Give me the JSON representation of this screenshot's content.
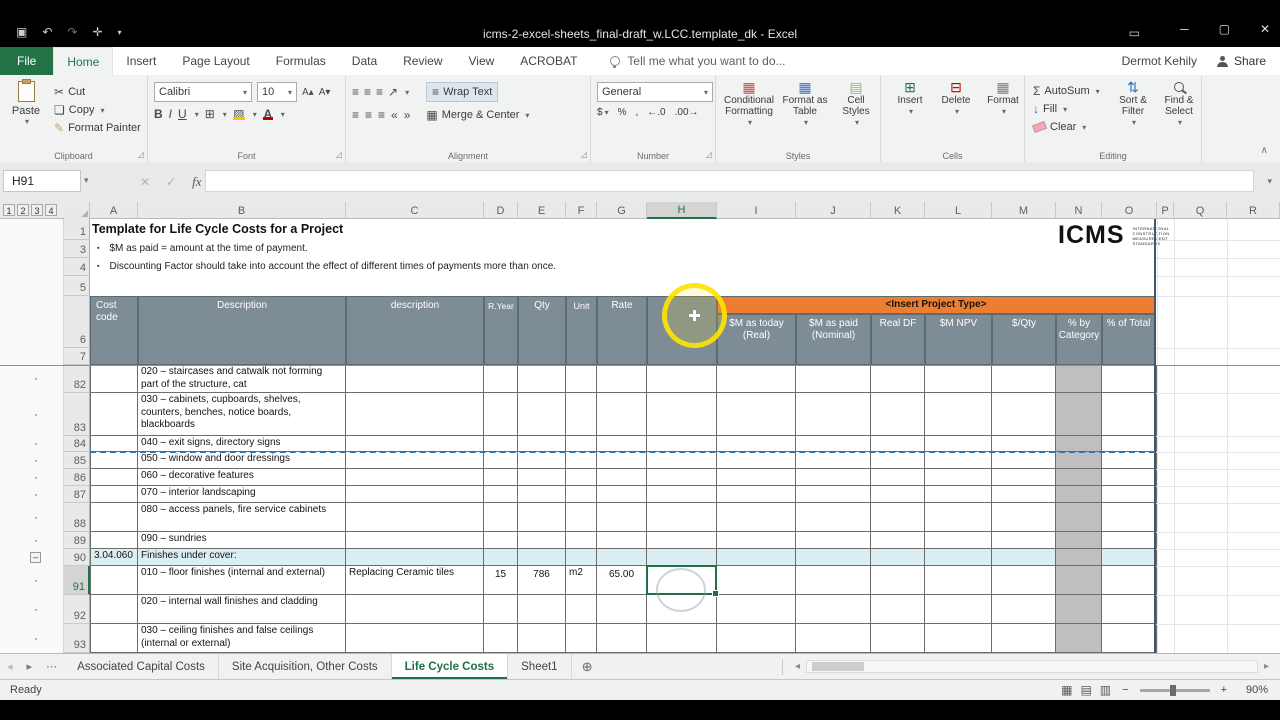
{
  "window": {
    "title": "icms-2-excel-sheets_final-draft_w.LCC.template_dk - Excel",
    "user": "Dermot Kehily",
    "share": "Share"
  },
  "icons": {
    "save": "▣",
    "undo": "↶",
    "redo": "↷",
    "touch": "✛",
    "qat_more": "▾",
    "presenter": "▭",
    "minimize": "─",
    "maximize": "▢",
    "close": "✕",
    "dropdown": "▾",
    "cut": "✂",
    "copy": "❏",
    "bold": "B",
    "italic": "I",
    "underline": "U",
    "borders": "⊞",
    "font_up": "A▴",
    "font_down": "A▾",
    "align": "≡",
    "indent_dec": "«",
    "indent_inc": "»",
    "orientation": "↗",
    "wrap": "≡",
    "merge": "▦",
    "currency": "$",
    "percent": "%",
    "comma": ",",
    "dec_inc": "←.0",
    "dec_dec": ".00→",
    "cond_format": "▦",
    "format_table": "▦",
    "cell_styles": "▤",
    "insert": "⊞",
    "delete": "⊟",
    "format": "▦",
    "sum": "Σ",
    "fill_down": "↓",
    "sort": "⇅",
    "cancel": "✕",
    "check": "✓",
    "fx": "fx",
    "nav_left": "◂",
    "nav_right": "▸",
    "more_tabs": "⋯",
    "add_sheet": "⊕",
    "view_normal": "▦",
    "view_layout": "▤",
    "view_break": "▥",
    "zoom_out": "−",
    "zoom_in": "+",
    "ribbon_collapse": "∧",
    "launcher": "◿",
    "bullet": "▪",
    "dot": "·",
    "minus_outline": "–",
    "corner_triangle": "◢",
    "plus_cursor": "✚"
  },
  "ribbon_tabs": [
    {
      "label": "File",
      "type": "file"
    },
    {
      "label": "Home",
      "active": true
    },
    {
      "label": "Insert"
    },
    {
      "label": "Page Layout"
    },
    {
      "label": "Formulas"
    },
    {
      "label": "Data"
    },
    {
      "label": "Review"
    },
    {
      "label": "View"
    },
    {
      "label": "ACROBAT"
    }
  ],
  "tellme": "Tell me what you want to do...",
  "ribbon": {
    "clipboard": {
      "label": "Clipboard",
      "paste": "Paste",
      "cut": "Cut",
      "copy": "Copy",
      "format_painter": "Format Painter"
    },
    "font": {
      "label": "Font",
      "name": "Calibri",
      "size": "10"
    },
    "alignment": {
      "label": "Alignment",
      "wrap": "Wrap Text",
      "merge": "Merge & Center"
    },
    "number": {
      "label": "Number",
      "format": "General"
    },
    "styles": {
      "label": "Styles",
      "conditional": "Conditional Formatting",
      "table": "Format as Table",
      "cell": "Cell Styles"
    },
    "cells": {
      "label": "Cells",
      "insert": "Insert",
      "delete": "Delete",
      "format": "Format"
    },
    "editing": {
      "label": "Editing",
      "autosum": "AutoSum",
      "fill": "Fill",
      "clear": "Clear",
      "sort": "Sort & Filter",
      "find": "Find & Select"
    }
  },
  "formula_bar": {
    "name_box": "H91"
  },
  "grid": {
    "columns": [
      "A",
      "B",
      "C",
      "D",
      "E",
      "F",
      "G",
      "H",
      "I",
      "J",
      "K",
      "L",
      "M",
      "N",
      "O",
      "P",
      "Q",
      "R"
    ],
    "outline_levels": [
      "1",
      "2",
      "3",
      "4"
    ],
    "top_rows": [
      "1",
      "3",
      "4",
      "5",
      "6",
      "7"
    ]
  },
  "sheet": {
    "title": "Template for Life Cycle Costs for a Project",
    "bullets": [
      "$M as paid = amount at the time of payment.",
      "Discounting Factor should take into account the effect of different times of payments more than once."
    ],
    "header": {
      "cost_code": "Cost code",
      "description": "Description",
      "description2": "description",
      "ryear": "R.Year",
      "qty": "Qty",
      "unit": "Unit",
      "rate": "Rate",
      "project": "<Insert Project Type>",
      "subs": [
        "$M as today (Real)",
        "$M as paid (Nominal)",
        "Real DF",
        "$M NPV",
        "$/Qty",
        "% by Category",
        "% of Total"
      ]
    },
    "rows": [
      {
        "num": "82",
        "cells": {
          "B": "020 – staircases and catwalk not forming part of the structure, cat"
        }
      },
      {
        "num": "83",
        "cells": {
          "B": "030 – cabinets, cupboards, shelves, counters, benches, notice boards, blackboards"
        }
      },
      {
        "num": "84",
        "cells": {
          "B": "040 – exit signs, directory signs"
        }
      },
      {
        "num": "85",
        "cells": {
          "B": "050 – window and door dressings"
        }
      },
      {
        "num": "86",
        "cells": {
          "B": "060 – decorative features"
        }
      },
      {
        "num": "87",
        "cells": {
          "B": "070 – interior landscaping"
        }
      },
      {
        "num": "88",
        "cells": {
          "B": "080 – access panels, fire service cabinets"
        }
      },
      {
        "num": "89",
        "cells": {
          "B": "090 – sundries"
        }
      },
      {
        "num": "90",
        "fill": "blue",
        "cells": {
          "A": "3.04.060",
          "B": "Finishes under cover:"
        }
      },
      {
        "num": "91",
        "selected": "H",
        "cells": {
          "B": "010 – floor finishes (internal and external)",
          "C": "Replacing Ceramic tiles",
          "D": "15",
          "E": "786",
          "F": "m2",
          "G": "65.00"
        }
      },
      {
        "num": "92",
        "cells": {
          "B": "020 – internal wall finishes and cladding"
        }
      },
      {
        "num": "93",
        "cells": {
          "B": "030 – ceiling finishes and false ceilings (internal or external)"
        }
      }
    ],
    "logo": {
      "name": "ICMS",
      "lines": [
        "INTERNATIONAL",
        "CONSTRUCTION",
        "MEASUREMENT",
        "STANDARDS"
      ]
    }
  },
  "sheet_tabs": [
    {
      "label": "Associated  Capital Costs"
    },
    {
      "label": "Site Acquisition, Other Costs"
    },
    {
      "label": "Life Cycle Costs",
      "active": true
    },
    {
      "label": "Sheet1"
    }
  ],
  "status": {
    "ready": "Ready",
    "zoom": "90%"
  },
  "colors": {
    "accent_green": "#217346",
    "header_gray": "#7e8c96",
    "band_orange": "#ed7d31",
    "col_n_gray": "#bfbfbf",
    "row90_blue": "#dbeef4",
    "page_break_blue": "#2e74b5",
    "selection_green": "#1f7145",
    "click_ring_yellow": "#fce205"
  }
}
